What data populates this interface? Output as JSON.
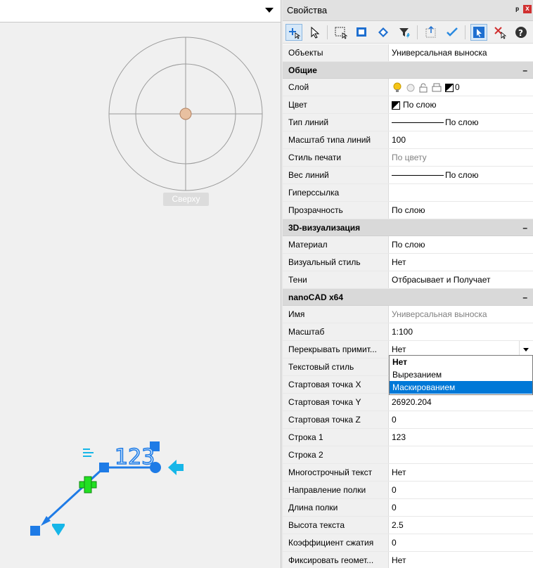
{
  "canvas": {
    "viewcube_label": "Сверху",
    "leader_text": "123",
    "colors": {
      "accent": "#1e7be6",
      "cyan": "#16b6e8",
      "green": "#22e022"
    }
  },
  "panel": {
    "title": "Свойства",
    "pin_icon": "pin-icon",
    "close_label": "x",
    "toolbar_icons": [
      "add-selection-icon",
      "select-cursor-icon",
      "select-window-icon",
      "quick-select-icon",
      "toggle-pickadd-icon",
      "filter-icon",
      "move-up-icon",
      "check-icon",
      "select-object-icon",
      "deselect-icon",
      "help-icon"
    ],
    "objects_key": "Объекты",
    "objects_value": "Универсальная выноска",
    "sections": {
      "general": "Общие",
      "viz": "3D-визуализация",
      "nano": "nanoCAD x64"
    },
    "rows": {
      "layer": {
        "k": "Слой",
        "v": "0"
      },
      "color": {
        "k": "Цвет",
        "v": "По слою"
      },
      "linetype": {
        "k": "Тип линий",
        "v": "По слою"
      },
      "ltscale": {
        "k": "Масштаб типа линий",
        "v": "100"
      },
      "plotstyle": {
        "k": "Стиль печати",
        "v": "По цвету"
      },
      "lineweight": {
        "k": "Вес линий",
        "v": "По слою"
      },
      "hyperlink": {
        "k": "Гиперссылка",
        "v": ""
      },
      "transparency": {
        "k": "Прозрачность",
        "v": "По слою"
      },
      "material": {
        "k": "Материал",
        "v": "По слою"
      },
      "visualstyle": {
        "k": "Визуальный стиль",
        "v": "Нет"
      },
      "shadows": {
        "k": "Тени",
        "v": "Отбрасывает и Получает"
      },
      "name": {
        "k": "Имя",
        "v": "Универсальная выноска"
      },
      "scale": {
        "k": "Масштаб",
        "v": "1:100"
      },
      "overlap": {
        "k": "Перекрывать примит...",
        "v": "Нет"
      },
      "textstyle": {
        "k": "Текстовый стиль",
        "v": ""
      },
      "startx": {
        "k": "Стартовая точка X",
        "v": ""
      },
      "starty": {
        "k": "Стартовая точка Y",
        "v": "26920.204"
      },
      "startz": {
        "k": "Стартовая точка Z",
        "v": "0"
      },
      "line1": {
        "k": "Строка 1",
        "v": "123"
      },
      "line2": {
        "k": "Строка 2",
        "v": ""
      },
      "mtext": {
        "k": "Многострочный текст",
        "v": "Нет"
      },
      "shelfdir": {
        "k": "Направление полки",
        "v": "0"
      },
      "shelflen": {
        "k": "Длина полки",
        "v": "0"
      },
      "textheight": {
        "k": "Высота текста",
        "v": "2.5"
      },
      "compress": {
        "k": "Коэффициент сжатия",
        "v": "0"
      },
      "fixgeom": {
        "k": "Фиксировать геомет...",
        "v": "Нет"
      }
    },
    "dropdown_options": [
      "Нет",
      "Вырезанием",
      "Маскированием"
    ]
  }
}
